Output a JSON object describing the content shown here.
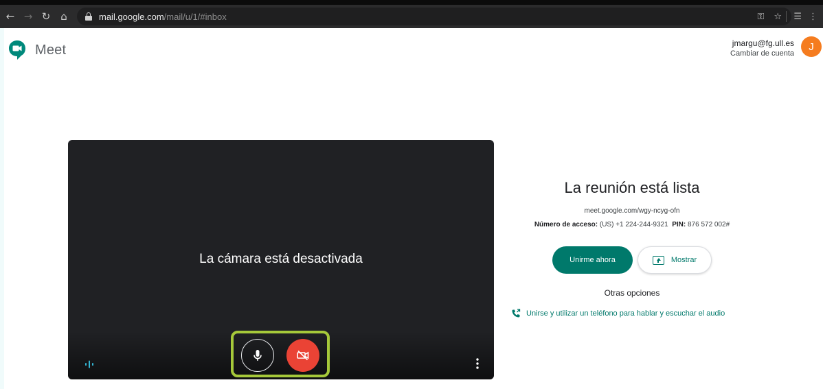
{
  "browser": {
    "url_host": "mail.google.com",
    "url_path": "/mail/u/1/#inbox",
    "icons": [
      "back-icon",
      "forward-icon",
      "reload-icon",
      "home-icon",
      "lock-icon",
      "key-icon",
      "star-icon",
      "reading-list-icon",
      "menu-icon"
    ]
  },
  "header": {
    "brand": "Meet",
    "account_email": "jmargu@fg.ull.es",
    "switch_account": "Cambiar de cuenta",
    "avatar_letter": "J"
  },
  "preview": {
    "camera_off_text": "La cámara está desactivada",
    "mic_state": "on",
    "camera_state": "off"
  },
  "panel": {
    "title": "La reunión está lista",
    "meeting_url": "meet.google.com/wgy-ncyg-ofn",
    "access_label": "Número de acceso:",
    "access_number": "(US) +1 224-244-9321",
    "pin_label": "PIN:",
    "pin_value": "876 572 002#",
    "join_label": "Unirme ahora",
    "present_label": "Mostrar",
    "other_options": "Otras opciones",
    "phone_audio": "Unirse y utilizar un teléfono para hablar y escuchar el audio"
  },
  "colors": {
    "accent": "#00796b",
    "camera_off": "#ea4335",
    "highlight": "#a6c93a",
    "avatar": "#f57c1f"
  }
}
